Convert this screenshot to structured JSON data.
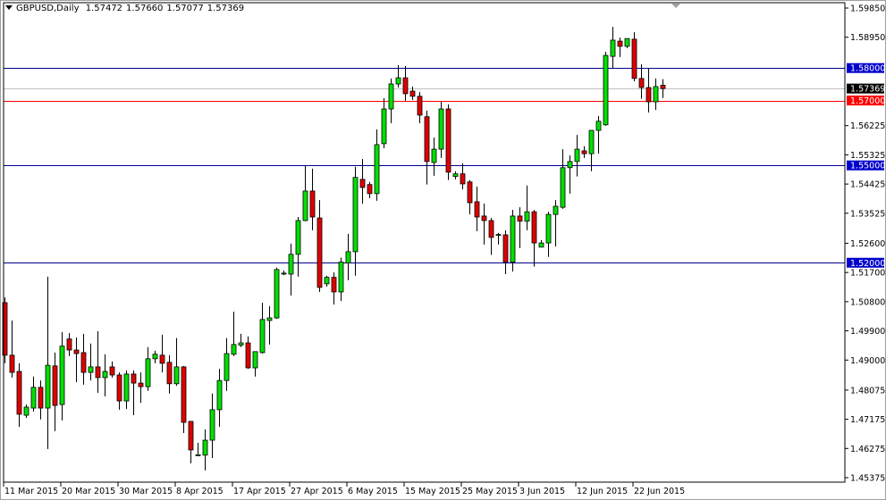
{
  "header": {
    "symbol_timeframe": "GBPUSD,Daily",
    "open": "1.57472",
    "high": "1.57660",
    "low": "1.57077",
    "close": "1.57369"
  },
  "colors": {
    "bull": "#00e000",
    "bear": "#e00000",
    "outline": "#000000",
    "level_line": "#00008b",
    "level_label_bg": "#0000cc",
    "red_line": "#ff0000",
    "bid_line": "#c0c0c0",
    "bid_label_bg": "#000000"
  },
  "chart_data": {
    "type": "candlestick",
    "title": "GBPUSD,Daily",
    "ylim": [
      1.45375,
      1.5985
    ],
    "grid": false,
    "ohlc": [
      [
        1.5077,
        1.5093,
        1.489,
        1.4915
      ],
      [
        1.4915,
        1.5022,
        1.4846,
        1.4862
      ],
      [
        1.4865,
        1.489,
        1.4694,
        1.4733
      ],
      [
        1.473,
        1.4763,
        1.4722,
        1.4755
      ],
      [
        1.4752,
        1.4849,
        1.4741,
        1.4816
      ],
      [
        1.4816,
        1.4837,
        1.4717,
        1.4752
      ],
      [
        1.4752,
        1.5157,
        1.4626,
        1.4884
      ],
      [
        1.4882,
        1.4923,
        1.4681,
        1.476
      ],
      [
        1.4763,
        1.4986,
        1.4714,
        1.4943
      ],
      [
        1.4965,
        1.4983,
        1.4912,
        1.4931
      ],
      [
        1.4931,
        1.497,
        1.4832,
        1.492
      ],
      [
        1.4923,
        1.4981,
        1.4824,
        1.4862
      ],
      [
        1.4862,
        1.4951,
        1.4837,
        1.4879
      ],
      [
        1.4879,
        1.4989,
        1.4799,
        1.4846
      ],
      [
        1.4846,
        1.4918,
        1.4788,
        1.4865
      ],
      [
        1.4879,
        1.4896,
        1.4846,
        1.4854
      ],
      [
        1.4854,
        1.4862,
        1.4747,
        1.4774
      ],
      [
        1.4774,
        1.4868,
        1.4749,
        1.4857
      ],
      [
        1.4857,
        1.4868,
        1.473,
        1.4829
      ],
      [
        1.4829,
        1.4862,
        1.4768,
        1.4818
      ],
      [
        1.4818,
        1.494,
        1.4805,
        1.4904
      ],
      [
        1.4904,
        1.4929,
        1.489,
        1.4918
      ],
      [
        1.4915,
        1.4978,
        1.4862,
        1.489
      ],
      [
        1.4893,
        1.4915,
        1.4797,
        1.4827
      ],
      [
        1.4827,
        1.4968,
        1.4821,
        1.4879
      ],
      [
        1.4879,
        1.4882,
        1.4675,
        1.4708
      ],
      [
        1.4711,
        1.4711,
        1.4582,
        1.4623
      ],
      [
        1.4607,
        1.4645,
        1.4607,
        1.4608
      ],
      [
        1.4607,
        1.4686,
        1.456,
        1.4653
      ],
      [
        1.4653,
        1.4797,
        1.4598,
        1.4747
      ],
      [
        1.4747,
        1.4873,
        1.4694,
        1.4837
      ],
      [
        1.4837,
        1.4968,
        1.4805,
        1.492
      ],
      [
        1.4918,
        1.5049,
        1.4912,
        1.4948
      ],
      [
        1.4946,
        1.4981,
        1.494,
        1.4953
      ],
      [
        1.4953,
        1.4973,
        1.4873,
        1.4876
      ],
      [
        1.4876,
        1.4926,
        1.4849,
        1.4926
      ],
      [
        1.4923,
        1.5077,
        1.492,
        1.5025
      ],
      [
        1.5022,
        1.5066,
        1.4948,
        1.503
      ],
      [
        1.503,
        1.5185,
        1.5027,
        1.5179
      ],
      [
        1.5165,
        1.5176,
        1.5162,
        1.5168
      ],
      [
        1.5165,
        1.5259,
        1.5099,
        1.5226
      ],
      [
        1.5226,
        1.5341,
        1.5157,
        1.533
      ],
      [
        1.533,
        1.5498,
        1.5328,
        1.5421
      ],
      [
        1.5421,
        1.549,
        1.53,
        1.5341
      ],
      [
        1.5338,
        1.5393,
        1.511,
        1.5124
      ],
      [
        1.5135,
        1.516,
        1.5126,
        1.5155
      ],
      [
        1.5155,
        1.517,
        1.5071,
        1.511
      ],
      [
        1.511,
        1.5216,
        1.5082,
        1.5202
      ],
      [
        1.5199,
        1.5289,
        1.5146,
        1.5234
      ],
      [
        1.5234,
        1.5496,
        1.516,
        1.5463
      ],
      [
        1.5457,
        1.552,
        1.5382,
        1.5432
      ],
      [
        1.5441,
        1.5449,
        1.5399,
        1.5413
      ],
      [
        1.5413,
        1.5611,
        1.5391,
        1.5564
      ],
      [
        1.5567,
        1.5707,
        1.5553,
        1.5674
      ],
      [
        1.5674,
        1.5768,
        1.563,
        1.5751
      ],
      [
        1.5751,
        1.5809,
        1.574,
        1.577
      ],
      [
        1.577,
        1.5806,
        1.5699,
        1.5721
      ],
      [
        1.5729,
        1.5743,
        1.5702,
        1.5713
      ],
      [
        1.5713,
        1.5726,
        1.563,
        1.5655
      ],
      [
        1.565,
        1.5669,
        1.5441,
        1.5512
      ],
      [
        1.5509,
        1.5586,
        1.5468,
        1.555
      ],
      [
        1.555,
        1.5696,
        1.5523,
        1.5674
      ],
      [
        1.5674,
        1.5688,
        1.5455,
        1.5479
      ],
      [
        1.5466,
        1.5482,
        1.5457,
        1.5474
      ],
      [
        1.5474,
        1.5506,
        1.5426,
        1.5443
      ],
      [
        1.5449,
        1.5455,
        1.5349,
        1.5385
      ],
      [
        1.5388,
        1.5435,
        1.5297,
        1.5341
      ],
      [
        1.5344,
        1.5382,
        1.5256,
        1.533
      ],
      [
        1.533,
        1.5338,
        1.5224,
        1.5278
      ],
      [
        1.5286,
        1.5292,
        1.5256,
        1.5287
      ],
      [
        1.5286,
        1.53,
        1.5165,
        1.5202
      ],
      [
        1.5202,
        1.5363,
        1.5173,
        1.5344
      ],
      [
        1.5344,
        1.5371,
        1.5245,
        1.5328
      ],
      [
        1.5328,
        1.5438,
        1.53,
        1.5357
      ],
      [
        1.5357,
        1.5363,
        1.5188,
        1.5261
      ],
      [
        1.5248,
        1.527,
        1.5248,
        1.5261
      ],
      [
        1.5261,
        1.5357,
        1.5218,
        1.5349
      ],
      [
        1.5349,
        1.5393,
        1.525,
        1.5374
      ],
      [
        1.5371,
        1.555,
        1.5366,
        1.5493
      ],
      [
        1.5493,
        1.5531,
        1.5413,
        1.5512
      ],
      [
        1.5512,
        1.5594,
        1.5466,
        1.555
      ],
      [
        1.5545,
        1.5559,
        1.5523,
        1.5536
      ],
      [
        1.5536,
        1.5608,
        1.5482,
        1.5608
      ],
      [
        1.5608,
        1.5652,
        1.5536,
        1.5636
      ],
      [
        1.5625,
        1.585,
        1.5622,
        1.5839
      ],
      [
        1.5836,
        1.5927,
        1.58,
        1.5886
      ],
      [
        1.5883,
        1.5894,
        1.5834,
        1.5867
      ],
      [
        1.5867,
        1.5891,
        1.5861,
        1.5891
      ],
      [
        1.5889,
        1.5911,
        1.5759,
        1.5768
      ],
      [
        1.5768,
        1.5812,
        1.5705,
        1.574
      ],
      [
        1.574,
        1.5798,
        1.5663,
        1.5696
      ],
      [
        1.5696,
        1.5768,
        1.5671,
        1.5743
      ],
      [
        1.57472,
        1.5766,
        1.57077,
        1.57369
      ]
    ],
    "y_ticks": [
      "1.59850",
      "1.58950",
      "1.56225",
      "1.55325",
      "1.54425",
      "1.53525",
      "1.52600",
      "1.51700",
      "1.50800",
      "1.49900",
      "1.49000",
      "1.48075",
      "1.47175",
      "1.46275",
      "1.45375"
    ],
    "x_ticks": [
      {
        "bar": 0,
        "label": "11 Mar 2015"
      },
      {
        "bar": 8,
        "label": "20 Mar 2015"
      },
      {
        "bar": 16,
        "label": "30 Mar 2015"
      },
      {
        "bar": 24,
        "label": "8 Apr 2015"
      },
      {
        "bar": 32,
        "label": "17 Apr 2015"
      },
      {
        "bar": 40,
        "label": "27 Apr 2015"
      },
      {
        "bar": 48,
        "label": "6 May 2015"
      },
      {
        "bar": 56,
        "label": "15 May 2015"
      },
      {
        "bar": 64,
        "label": "25 May 2015"
      },
      {
        "bar": 72,
        "label": "3 Jun 2015"
      },
      {
        "bar": 80,
        "label": "12 Jun 2015"
      },
      {
        "bar": 88,
        "label": "22 Jun 2015"
      }
    ],
    "levels": [
      {
        "value": 1.58,
        "label": "1.58000",
        "kind": "blue"
      },
      {
        "value": 1.57,
        "label": "1.57000",
        "kind": "red"
      },
      {
        "value": 1.55,
        "label": "1.55000",
        "kind": "blue"
      },
      {
        "value": 1.52,
        "label": "1.52000",
        "kind": "blue"
      }
    ],
    "bid": {
      "value": 1.57369,
      "label": "1.57369"
    }
  }
}
